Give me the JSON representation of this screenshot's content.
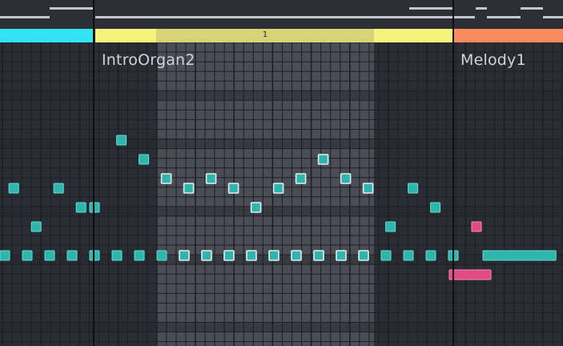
{
  "clips": [
    {
      "id": "left",
      "name": "",
      "color": "#33e3f0"
    },
    {
      "id": "intro",
      "name": "IntroOrgan2",
      "color": "#f7f27a",
      "loop_color": "#d6d476",
      "loop_label": "1"
    },
    {
      "id": "melody",
      "name": "Melody1",
      "color": "#fb8a5c"
    }
  ],
  "colors": {
    "note_fill": "#2fb5ac",
    "note_border": "#62e0d6",
    "note_selected_border": "#e6ecef",
    "note_pink": "#e24a86",
    "note_pink_border": "#ff8ab8",
    "grid_bg": "#2a2d33",
    "grid_loop_bg": "#4a4d55",
    "grid_line": "#1d2024",
    "grid_row_dark": "#25282d"
  },
  "notes": [
    {
      "clip": "left",
      "beat": 0,
      "pitch": 10
    },
    {
      "clip": "left",
      "beat": 1,
      "pitch": 10
    },
    {
      "clip": "left",
      "beat": 2,
      "pitch": 10
    },
    {
      "clip": "left",
      "beat": 3,
      "pitch": 10
    },
    {
      "clip": "left",
      "beat": 4,
      "pitch": 10
    },
    {
      "clip": "left",
      "beat": 0.4,
      "pitch": 17
    },
    {
      "clip": "left",
      "beat": 2.4,
      "pitch": 17
    },
    {
      "clip": "left",
      "beat": 1.4,
      "pitch": 13
    },
    {
      "clip": "left",
      "beat": 3.4,
      "pitch": 15
    },
    {
      "clip": "intro",
      "beat": 0,
      "pitch": 15
    },
    {
      "clip": "intro",
      "beat": 1,
      "pitch": 10
    },
    {
      "clip": "intro",
      "beat": 2,
      "pitch": 10
    },
    {
      "clip": "intro",
      "beat": 3,
      "pitch": 10
    },
    {
      "clip": "intro",
      "beat": 1.2,
      "pitch": 22
    },
    {
      "clip": "intro",
      "beat": 2.2,
      "pitch": 20
    },
    {
      "clip": "intro",
      "beat": 3.2,
      "pitch": 18
    },
    {
      "clip": "intro",
      "beat": 4,
      "pitch": 10,
      "selected": true
    },
    {
      "clip": "intro",
      "beat": 5,
      "pitch": 10,
      "selected": true
    },
    {
      "clip": "intro",
      "beat": 6,
      "pitch": 10,
      "selected": true
    },
    {
      "clip": "intro",
      "beat": 7,
      "pitch": 10,
      "selected": true
    },
    {
      "clip": "intro",
      "beat": 8,
      "pitch": 10,
      "selected": true
    },
    {
      "clip": "intro",
      "beat": 9,
      "pitch": 10,
      "selected": true
    },
    {
      "clip": "intro",
      "beat": 10,
      "pitch": 10,
      "selected": true
    },
    {
      "clip": "intro",
      "beat": 11,
      "pitch": 10,
      "selected": true
    },
    {
      "clip": "intro",
      "beat": 12,
      "pitch": 10,
      "selected": true
    },
    {
      "clip": "intro",
      "beat": 3.2,
      "pitch": 18,
      "selected": true
    },
    {
      "clip": "intro",
      "beat": 4.2,
      "pitch": 17,
      "selected": true
    },
    {
      "clip": "intro",
      "beat": 5.2,
      "pitch": 18,
      "selected": true
    },
    {
      "clip": "intro",
      "beat": 6.2,
      "pitch": 17,
      "selected": true
    },
    {
      "clip": "intro",
      "beat": 7.2,
      "pitch": 15,
      "selected": true
    },
    {
      "clip": "intro",
      "beat": 8.2,
      "pitch": 17,
      "selected": true
    },
    {
      "clip": "intro",
      "beat": 9.2,
      "pitch": 18,
      "selected": true
    },
    {
      "clip": "intro",
      "beat": 10.2,
      "pitch": 20,
      "selected": true
    },
    {
      "clip": "intro",
      "beat": 11.2,
      "pitch": 18,
      "selected": true
    },
    {
      "clip": "intro",
      "beat": 12.2,
      "pitch": 17,
      "selected": true
    },
    {
      "clip": "intro",
      "beat": 13,
      "pitch": 10
    },
    {
      "clip": "intro",
      "beat": 14,
      "pitch": 10
    },
    {
      "clip": "intro",
      "beat": 15,
      "pitch": 10
    },
    {
      "clip": "intro",
      "beat": 16,
      "pitch": 10
    },
    {
      "clip": "intro",
      "beat": 13.2,
      "pitch": 13
    },
    {
      "clip": "intro",
      "beat": 14.2,
      "pitch": 17
    },
    {
      "clip": "intro",
      "beat": 15.2,
      "pitch": 15
    },
    {
      "clip": "melody",
      "beat": 1,
      "pitch": 13,
      "color": "pink"
    },
    {
      "clip": "melody",
      "beat": 0,
      "pitch": 8,
      "color": "pink",
      "length": 2
    },
    {
      "clip": "melody",
      "beat": 1.5,
      "pitch": 10,
      "length": 3.4
    }
  ]
}
